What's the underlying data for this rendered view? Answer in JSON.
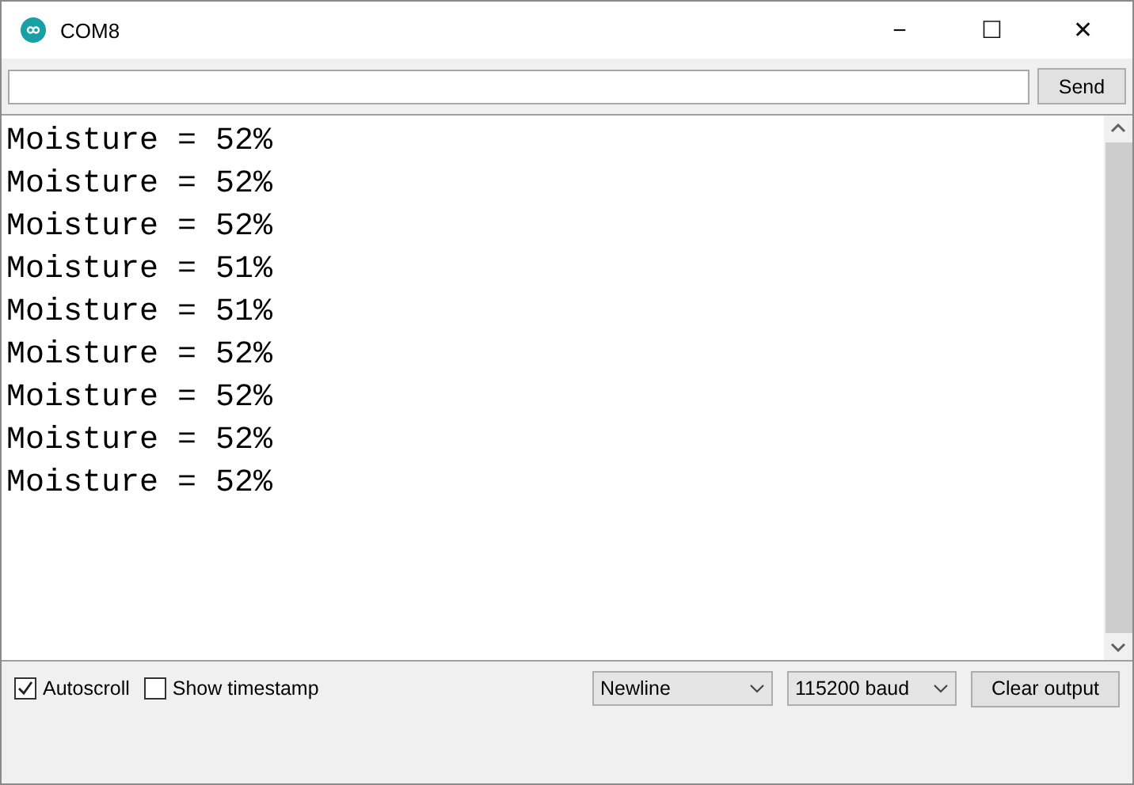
{
  "window": {
    "title": "COM8",
    "controls": [
      "−",
      "☐",
      "✕"
    ]
  },
  "send_button": "Send",
  "output_lines": [
    "Moisture = 52%",
    "Moisture = 52%",
    "Moisture = 52%",
    "Moisture = 51%",
    "Moisture = 51%",
    "Moisture = 52%",
    "Moisture = 52%",
    "Moisture = 52%",
    "Moisture = 52%"
  ],
  "footer": {
    "checkboxes": [
      {
        "label": "Autoscroll",
        "checked": true
      },
      {
        "label": "Show timestamp",
        "checked": false
      }
    ],
    "dropdowns": [
      "Newline",
      "115200 baud"
    ],
    "clear_button": "Clear output"
  }
}
